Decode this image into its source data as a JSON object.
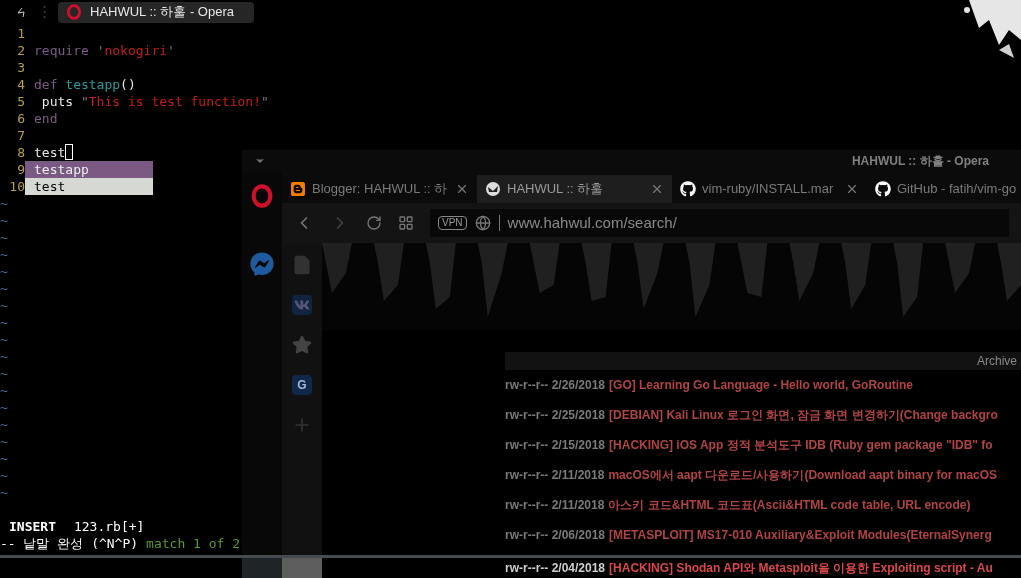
{
  "taskbar": {
    "tasks": [
      {
        "title": "HAHWUL :: 하훌 - Opera",
        "selected": true
      }
    ]
  },
  "browser": {
    "title": "HAHWUL :: 하훌 - Opera",
    "tabs": [
      {
        "label": "Blogger: HAHWUL :: 하",
        "kind": "blogger",
        "selected": false
      },
      {
        "label": "HAHWUL :: 하훌",
        "kind": "site",
        "selected": true
      },
      {
        "label": "vim-ruby/INSTALL.mar",
        "kind": "github",
        "selected": false
      },
      {
        "label": "GitHub - fatih/vim-go",
        "kind": "github",
        "selected": false
      }
    ],
    "address": {
      "vpn": "VPN",
      "url": "www.hahwul.com/search/"
    },
    "panel": [
      {
        "kind": "page"
      },
      {
        "kind": "vk"
      },
      {
        "kind": "star"
      },
      {
        "kind": "badge",
        "text": "G"
      },
      {
        "kind": "add"
      }
    ],
    "archive": {
      "heading": "Archive",
      "posts": [
        {
          "meta": "rw-r--r-- 2/26/2018",
          "title": "[GO] Learning Go Language - Hello world, GoRoutine"
        },
        {
          "meta": "rw-r--r-- 2/25/2018",
          "title": "[DEBIAN] Kali Linux 로그인 화면, 잠금 화면 변경하기(Change backgro"
        },
        {
          "meta": "rw-r--r-- 2/15/2018",
          "title": "[HACKING] iOS App 정적 분석도구 IDB (Ruby gem package \"IDB\" fo"
        },
        {
          "meta": "rw-r--r-- 2/11/2018",
          "title": "macOS에서 aapt 다운로드/사용하기(Download aapt binary for macOS"
        },
        {
          "meta": "rw-r--r-- 2/11/2018",
          "title": "아스키 코드&HTML 코드표(Ascii&HTML code table, URL encode)"
        },
        {
          "meta": "rw-r--r-- 2/06/2018",
          "title": "[METASPLOIT] MS17-010 Auxiliary&Exploit Modules(EternalSynerg"
        },
        {
          "meta": "rw-r--r-- 2/04/2018",
          "title": "[HACKING] Shodan API와 Metasploit을 이용한 Exploiting script - Au"
        }
      ]
    }
  },
  "editor": {
    "lines": [
      {
        "number": "1",
        "cursor": false
      },
      {
        "number": "2",
        "cursor": false,
        "tokens": [
          {
            "text": "require ",
            "kind": "keyword"
          },
          {
            "text": "'",
            "kind": "quote"
          },
          {
            "text": "nokogiri",
            "kind": "string"
          },
          {
            "text": "'",
            "kind": "quote"
          }
        ]
      },
      {
        "number": "3",
        "cursor": false
      },
      {
        "number": "4",
        "cursor": false,
        "tokens": [
          {
            "text": "def ",
            "kind": "keyword"
          },
          {
            "text": "testapp",
            "kind": "function"
          },
          {
            "text": "()",
            "kind": "plain"
          }
        ]
      },
      {
        "number": "5",
        "cursor": false,
        "tokens": [
          {
            "text": " puts ",
            "kind": "plain"
          },
          {
            "text": "\"",
            "kind": "quote"
          },
          {
            "text": "This is test function!",
            "kind": "string"
          },
          {
            "text": "\"",
            "kind": "quote"
          }
        ]
      },
      {
        "number": "6",
        "cursor": false,
        "tokens": [
          {
            "text": "end",
            "kind": "keyword"
          }
        ]
      },
      {
        "number": "7",
        "cursor": false
      },
      {
        "number": "8",
        "cursor": true,
        "tokens": [
          {
            "text": "test",
            "kind": "plain"
          }
        ]
      },
      {
        "number": "9",
        "cursor": false
      },
      {
        "number": "10",
        "cursor": false
      }
    ],
    "completion": [
      {
        "text": "testapp",
        "selected": true
      },
      {
        "text": "test",
        "selected": false
      }
    ],
    "filler": [
      "~",
      "~",
      "~",
      "~",
      "~",
      "~",
      "~",
      "~",
      "~",
      "~",
      "~",
      "~",
      "~",
      "~",
      "~",
      "~",
      "~",
      "~"
    ],
    "status": {
      "mode": "INSERT",
      "file": "123.rb[+]"
    },
    "message": {
      "text": "-- 낱말 완성 (^N^P)",
      "match": "match 1 of 2"
    }
  }
}
